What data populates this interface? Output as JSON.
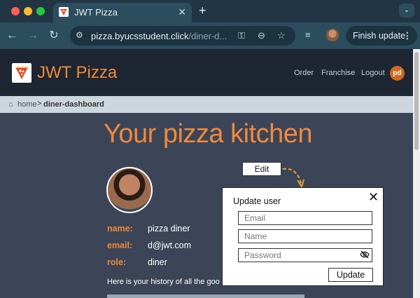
{
  "browser": {
    "tab_title": "JWT Pizza",
    "tab_close": "✕",
    "new_tab": "+",
    "url_host": "pizza.byucsstudent.click",
    "url_path": "/diner-d...",
    "finish_update": "Finish update",
    "more": "⋮",
    "icons": [
      "back-icon",
      "forward-icon",
      "reload-icon",
      "site-info-icon",
      "key-icon",
      "zoom-icon",
      "star-icon",
      "media-icon",
      "profile-avatar"
    ]
  },
  "header": {
    "brand": "JWT Pizza",
    "nav": [
      "Order",
      "Franchise",
      "Logout"
    ],
    "user_initials": "pd",
    "brand_color": "#f08a3a"
  },
  "breadcrumb": {
    "home": "home",
    "separator": ">",
    "current": "diner-dashboard"
  },
  "main": {
    "title": "Your pizza kitchen",
    "fields": [
      {
        "label": "name:",
        "value": "pizza diner"
      },
      {
        "label": "email:",
        "value": "d@jwt.com"
      },
      {
        "label": "role:",
        "value": "diner"
      }
    ],
    "history_text": "Here is your history of all the goo"
  },
  "annotation": {
    "edit_label": "Edit"
  },
  "modal": {
    "title": "Update user",
    "close": "✕",
    "email_placeholder": "Email",
    "name_placeholder": "Name",
    "password_placeholder": "Password",
    "update_button": "Update"
  }
}
